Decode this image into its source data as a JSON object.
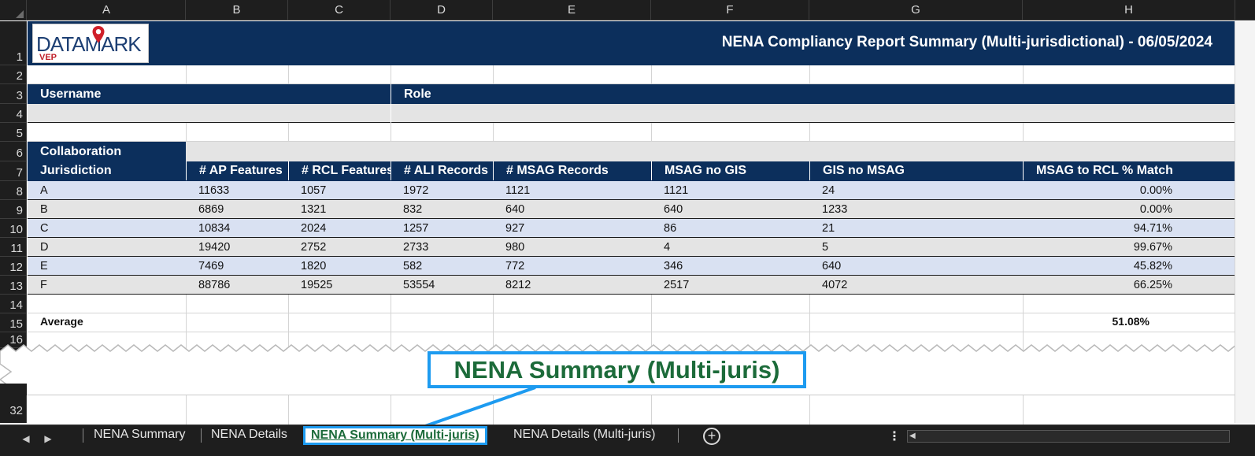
{
  "columns": [
    "A",
    "B",
    "C",
    "D",
    "E",
    "F",
    "G",
    "H"
  ],
  "rows": [
    "1",
    "2",
    "3",
    "4",
    "5",
    "6",
    "7",
    "8",
    "9",
    "10",
    "11",
    "12",
    "13",
    "14",
    "15",
    "16",
    "32"
  ],
  "logo": {
    "main": "DATAMARK",
    "sub": "VEP",
    "pin_color": "#d0202a"
  },
  "report": {
    "title": "NENA Compliancy Report Summary (Multi-jurisdictional) - 06/05/2024"
  },
  "user_section": {
    "username_label": "Username",
    "role_label": "Role"
  },
  "collaboration_label": "Collaboration",
  "table": {
    "headers": [
      "Jurisdiction",
      "# AP Features",
      "# RCL Features",
      "# ALI Records",
      "# MSAG Records",
      "MSAG no GIS",
      "GIS no MSAG",
      "MSAG to RCL % Match"
    ],
    "rows": [
      [
        "A",
        "11633",
        "1057",
        "1972",
        "1121",
        "1121",
        "24",
        "0.00%"
      ],
      [
        "B",
        "6869",
        "1321",
        "832",
        "640",
        "640",
        "1233",
        "0.00%"
      ],
      [
        "C",
        "10834",
        "2024",
        "1257",
        "927",
        "86",
        "21",
        "94.71%"
      ],
      [
        "D",
        "19420",
        "2752",
        "2733",
        "980",
        "4",
        "5",
        "99.67%"
      ],
      [
        "E",
        "7469",
        "1820",
        "582",
        "772",
        "346",
        "640",
        "45.82%"
      ],
      [
        "F",
        "88786",
        "19525",
        "53554",
        "8212",
        "2517",
        "4072",
        "66.25%"
      ]
    ],
    "average_label": "Average",
    "average_value": "51.08%"
  },
  "callout": "NENA Summary (Multi-juris)",
  "tabs": [
    {
      "label": "NENA Summary"
    },
    {
      "label": "NENA Details"
    },
    {
      "label": "NENA Summary (Multi-juris)"
    },
    {
      "label": "NENA Details (Multi-juris)"
    }
  ],
  "icons": {
    "prev": "chevron-left-icon",
    "next": "chevron-right-icon",
    "add": "add-sheet-icon",
    "more": "more-options-icon"
  },
  "colors": {
    "navy": "#0c2f5c",
    "row_blue": "#d9e1f2",
    "row_gray": "#e4e4e4",
    "callout_border": "#1d9bf0",
    "callout_text": "#1c6b3a"
  }
}
